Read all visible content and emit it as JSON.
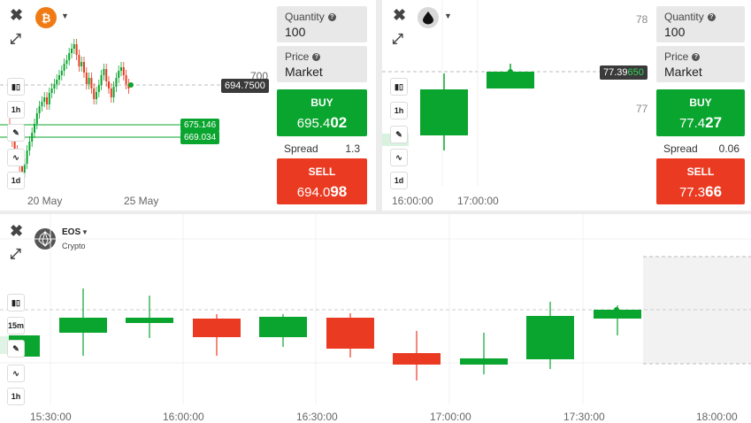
{
  "panel1": {
    "price_label_700": "700",
    "current_price_tag": "694.7500",
    "level1_tag": "675.146",
    "level2_tag": "669.034",
    "x_labels": [
      "20 May",
      "25 May"
    ],
    "timeframe": "1h",
    "timeframe2": "1d",
    "quantity": {
      "label": "Quantity",
      "value": "100"
    },
    "price": {
      "label": "Price",
      "value": "Market"
    },
    "buy": {
      "label": "BUY",
      "price_main": "695.4",
      "price_bold": "02"
    },
    "spread": {
      "label": "Spread",
      "value": "1.3"
    },
    "sell": {
      "label": "SELL",
      "price_main": "694.0",
      "price_bold": "98"
    }
  },
  "panel2": {
    "y_labels": [
      "78",
      "77"
    ],
    "current_price_tag_main": "77.39",
    "current_price_tag_accent": "650",
    "x_labels": [
      "16:00:00",
      "17:00:00"
    ],
    "timeframe": "1h",
    "timeframe2": "1d",
    "quantity": {
      "label": "Quantity",
      "value": "100"
    },
    "price": {
      "label": "Price",
      "value": "Market"
    },
    "buy": {
      "label": "BUY",
      "price_main": "77.4",
      "price_bold": "27"
    },
    "spread": {
      "label": "Spread",
      "value": "0.06"
    },
    "sell": {
      "label": "SELL",
      "price_main": "77.3",
      "price_bold": "66"
    }
  },
  "panel3": {
    "asset_name": "EOS",
    "asset_category": "Crypto",
    "timeframe": "15m",
    "timeframe2": "1h",
    "x_labels": [
      "15:30:00",
      "16:00:00",
      "16:30:00",
      "17:00:00",
      "17:30:00",
      "18:00:00"
    ]
  },
  "colors": {
    "green": "#0aa52e",
    "red": "#ea3b22",
    "dark_tag": "#3a3a3a"
  }
}
